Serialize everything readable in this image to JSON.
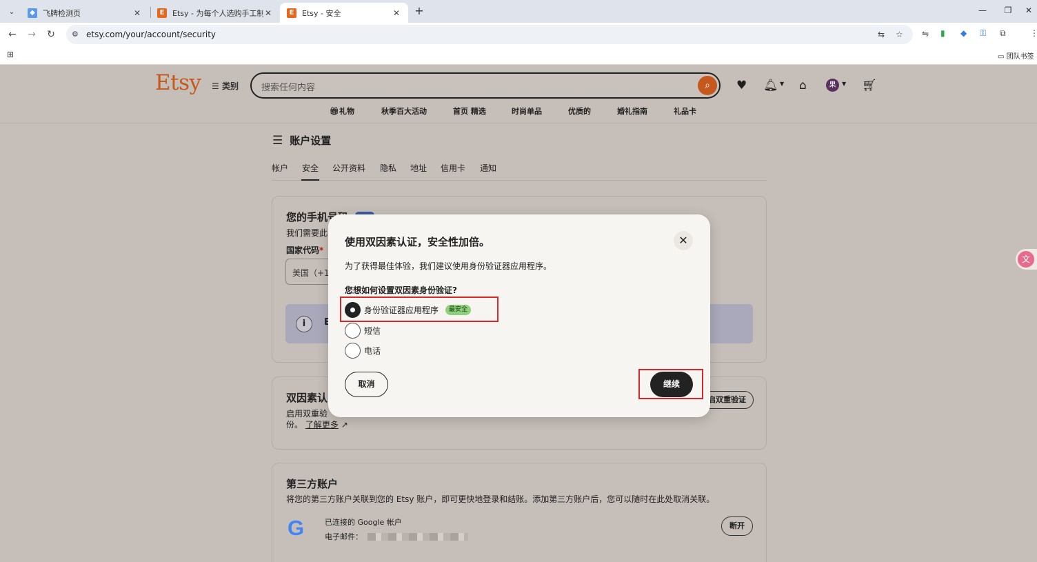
{
  "browser": {
    "tabs": [
      {
        "title": "飞牌检测页",
        "close": "✕"
      },
      {
        "title": "Etsy - 为每个人选购手工制作...",
        "close": "✕"
      },
      {
        "title": "Etsy - 安全",
        "close": "✕"
      }
    ],
    "new_tab": "+",
    "url": "etsy.com/your/account/security",
    "bookmark_folder": "团队书签"
  },
  "header": {
    "logo": "Etsy",
    "categories_label": "类别",
    "search_placeholder": "搜索任何内容",
    "avatar_letter": "果",
    "nav": [
      "礼物",
      "秋季百大活动",
      "首页 精选",
      "时尚单品",
      "优质的",
      "婚礼指南",
      "礼品卡"
    ]
  },
  "account": {
    "title": "账户设置",
    "tabs": [
      "帐户",
      "安全",
      "公开资料",
      "隐私",
      "地址",
      "信用卡",
      "通知"
    ],
    "active_tab": "安全"
  },
  "phone_card": {
    "title": "您的手机号码",
    "desc": "我们需要此",
    "country_label": "国家代码",
    "required_mark": "*",
    "country_value": "美国（+1",
    "info_letter": "E"
  },
  "two_factor_card": {
    "title": "双因素认",
    "desc_line1": "启用双重验",
    "desc_line2": "份。",
    "learn_more": "了解更多",
    "enable_button": "启双重验证"
  },
  "third_party_card": {
    "title": "第三方账户",
    "desc": "将您的第三方账户关联到您的 Etsy 账户，即可更快地登录和结账。添加第三方账户后，您可以随时在此处取消关联。",
    "google_label": "已连接的 Google 帐户",
    "email_label": "电子邮件：",
    "disconnect_button": "断开"
  },
  "modal": {
    "title": "使用双因素认证，安全性加倍。",
    "subtitle": "为了获得最佳体验，我们建议使用身份验证器应用程序。",
    "question": "您想如何设置双因素身份验证?",
    "options": [
      {
        "label": "身份验证器应用程序",
        "badge": "最安全",
        "selected": true
      },
      {
        "label": "短信",
        "selected": false
      },
      {
        "label": "电话",
        "selected": false
      }
    ],
    "cancel": "取消",
    "continue": "继续"
  },
  "colors": {
    "brand": "#c4581d",
    "highlight": "#d8262a",
    "badge": "#8fd07c"
  }
}
